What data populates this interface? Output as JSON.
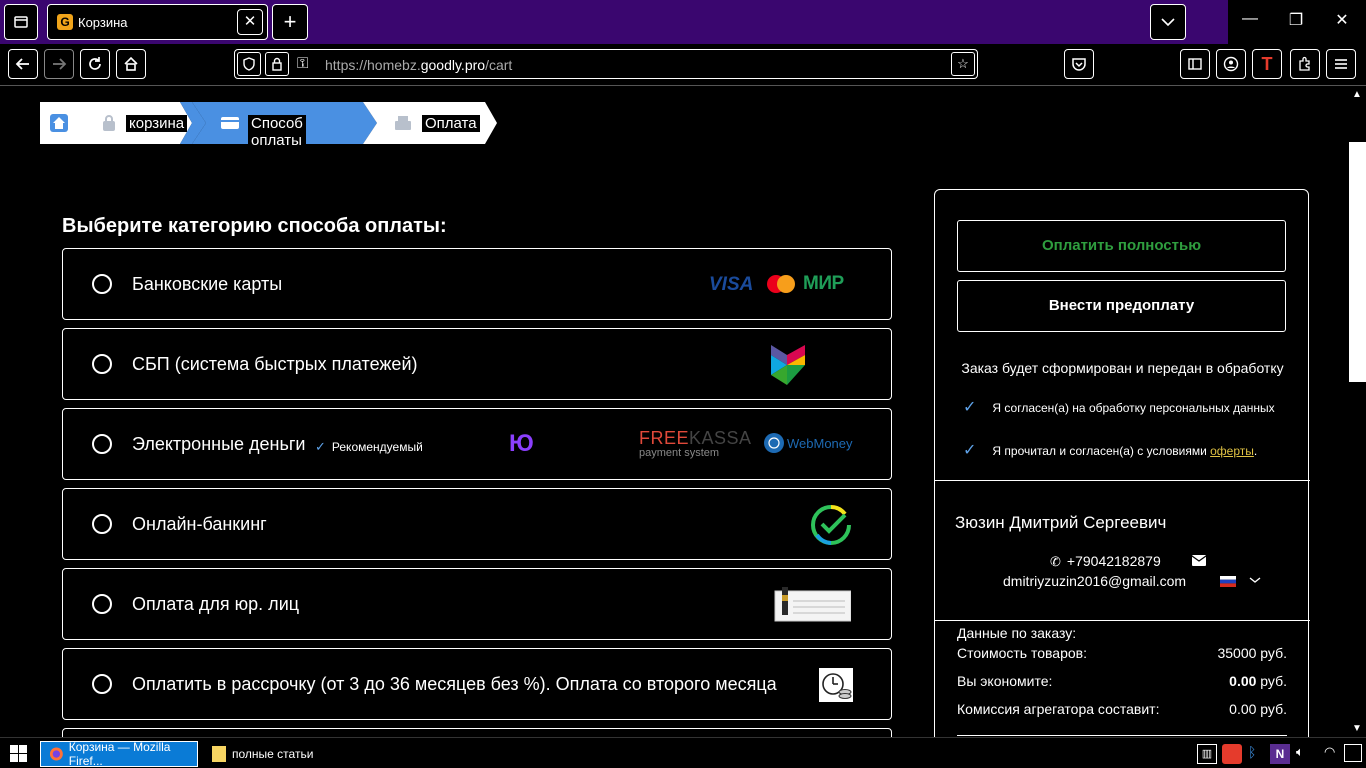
{
  "browser": {
    "tab_title": "Корзина",
    "tab_close": "✕",
    "new_tab": "+",
    "url_host_pre": "https://homebz.",
    "url_host_main": "goodly.pro",
    "url_path": "/cart"
  },
  "breadcrumbs": [
    {
      "label": "корзина"
    },
    {
      "label": "Способ оплаты"
    },
    {
      "label": "Оплата"
    }
  ],
  "main": {
    "section_title": "Выберите категорию способа оплаты:",
    "methods": [
      {
        "label": "Банковские карты"
      },
      {
        "label": "СБП (система быстрых платежей)"
      },
      {
        "label": "Электронные деньги",
        "badge": "Рекомендуемый"
      },
      {
        "label": "Онлайн-банкинг"
      },
      {
        "label": "Оплата для юр. лиц"
      },
      {
        "label": "Оплатить в рассрочку (от 3 до 36 месяцев без %). Оплата со второго месяца"
      }
    ],
    "logos": {
      "visa": "VISA",
      "mir": "МИР",
      "yoomoney": "Ю",
      "freekassa_a": "FREE",
      "freekassa_b": "KASSA",
      "freekassa_sub": "payment system",
      "webmoney": "WebMoney"
    }
  },
  "sidebar": {
    "btn_full": "Оплатить полностью",
    "btn_prepay": "Внести предоплату",
    "order_note": "Заказ будет сформирован и передан в обработку",
    "agree1": "Я согласен(а) на обработку персональных данных",
    "agree2_pre": "Я прочитал и согласен(а) с условиями ",
    "agree2_link": "оферты",
    "agree2_post": ".",
    "customer_name": "Зюзин Дмитрий Сергеевич",
    "customer_phone": "+79042182879",
    "customer_email": "dmitriyzuzin2016@gmail.com",
    "summary_head": "Данные по заказу:",
    "rows": [
      {
        "label": "Стоимость товаров:",
        "value": "35000 руб."
      },
      {
        "label": "Вы экономите:",
        "value_bold": "0.00",
        "value_unit": " руб."
      },
      {
        "label": "Комиссия агрегатора составит:",
        "value": "0.00 руб."
      }
    ]
  },
  "taskbar": {
    "firefox": "Корзина — Mozilla Firef...",
    "folder": "полные статьи"
  },
  "colors": {
    "tabbar": "#3a066f",
    "accent_blue": "#4a90e2",
    "green": "#2f9e3f",
    "link": "#e0c244"
  }
}
